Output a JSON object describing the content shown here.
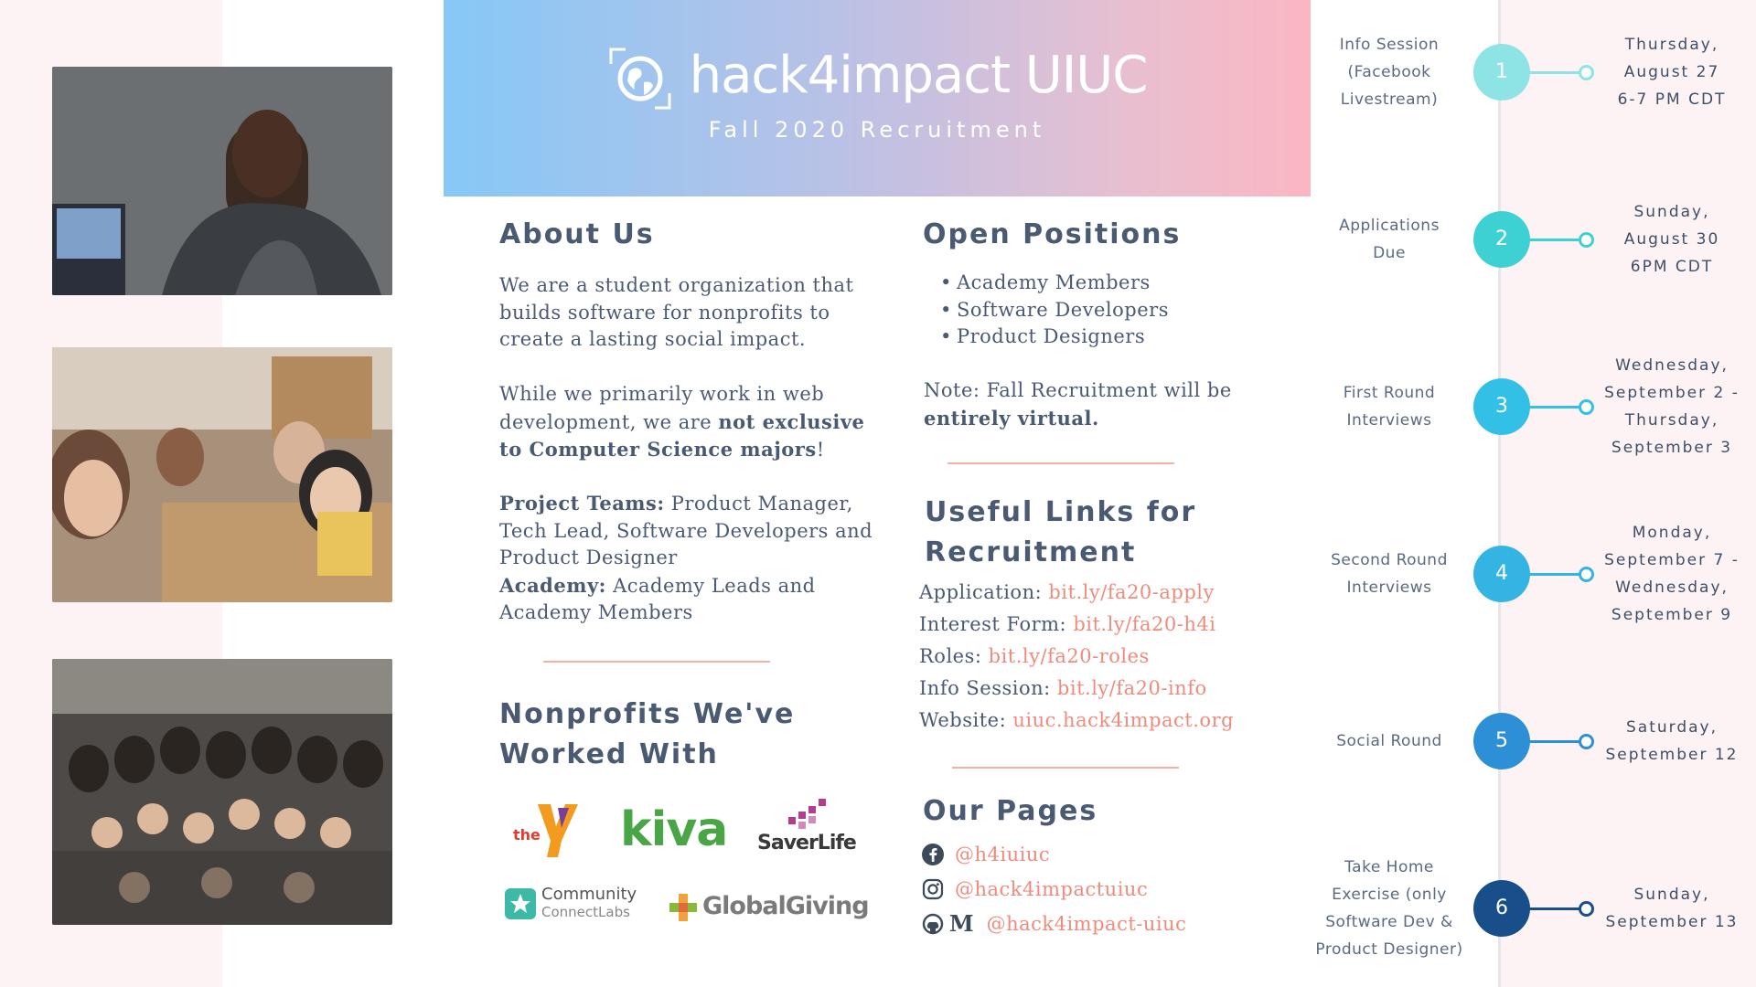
{
  "banner": {
    "title": "hack4impact UIUC",
    "subtitle": "Fall 2020 Recruitment"
  },
  "about": {
    "heading": "About Us",
    "p1": "We are a student organization that builds software for nonprofits to create a lasting social impact.",
    "p2_pre": "While we primarily work in web development, we are ",
    "p2_bold": "not exclusive to Computer Science majors",
    "p2_post": "!",
    "teams_label": "Project Teams:",
    "teams_text": " Product Manager, Tech Lead, Software Developers and Product Designer",
    "academy_label": "Academy:",
    "academy_text": " Academy Leads and Academy Members"
  },
  "nonprofits": {
    "heading_line1": "Nonprofits We've",
    "heading_line2": "Worked With",
    "logos": {
      "ymca": "the",
      "kiva": "kiva",
      "saverlife": "SaverLife",
      "community1": "Community",
      "community2": "ConnectLabs",
      "globalgiving": "GlobalGiving"
    }
  },
  "positions": {
    "heading": "Open Positions",
    "items": [
      "Academy Members",
      "Software Developers",
      "Product Designers"
    ],
    "note_pre": "Note: Fall Recruitment will be ",
    "note_bold": "entirely virtual."
  },
  "links": {
    "heading_line1": "Useful Links for",
    "heading_line2": "Recruitment",
    "items": [
      {
        "label": "Application: ",
        "url": "bit.ly/fa20-apply"
      },
      {
        "label": "Interest Form: ",
        "url": "bit.ly/fa20-h4i"
      },
      {
        "label": "Roles: ",
        "url": "bit.ly/fa20-roles"
      },
      {
        "label": "Info Session: ",
        "url": "bit.ly/fa20-info"
      },
      {
        "label": "Website: ",
        "url": "uiuc.hack4impact.org"
      }
    ]
  },
  "pages": {
    "heading": "Our Pages",
    "facebook": "@h4iuiuc",
    "instagram": "@hack4impactuiuc",
    "github_medium": "@hack4impact-uiuc",
    "medium_letter": "M"
  },
  "timeline": {
    "steps": [
      {
        "num": "1",
        "event": [
          "Info Session",
          "(Facebook",
          "Livestream)"
        ],
        "date": [
          "Thursday,",
          "August 27",
          "6-7 PM CDT"
        ],
        "color": "#8ee3e4"
      },
      {
        "num": "2",
        "event": [
          "Applications",
          "Due"
        ],
        "date": [
          "Sunday,",
          "August 30",
          "6PM CDT"
        ],
        "color": "#3ed1d3"
      },
      {
        "num": "3",
        "event": [
          "First Round",
          "Interviews"
        ],
        "date": [
          "Wednesday,",
          "September 2 -",
          "Thursday,",
          "September 3"
        ],
        "color": "#32c0e6"
      },
      {
        "num": "4",
        "event": [
          "Second Round",
          "Interviews"
        ],
        "date": [
          "Monday,",
          "September 7 -",
          "Wednesday,",
          "September 9"
        ],
        "color": "#33b4e3"
      },
      {
        "num": "5",
        "event": [
          "Social Round"
        ],
        "date": [
          "Saturday,",
          "September 12"
        ],
        "color": "#2d8fd6"
      },
      {
        "num": "6",
        "event": [
          "Take Home",
          "Exercise (only",
          "Software Dev &",
          "Product Designer)"
        ],
        "date": [
          "Sunday,",
          "September 13"
        ],
        "color": "#184f8a"
      }
    ]
  }
}
